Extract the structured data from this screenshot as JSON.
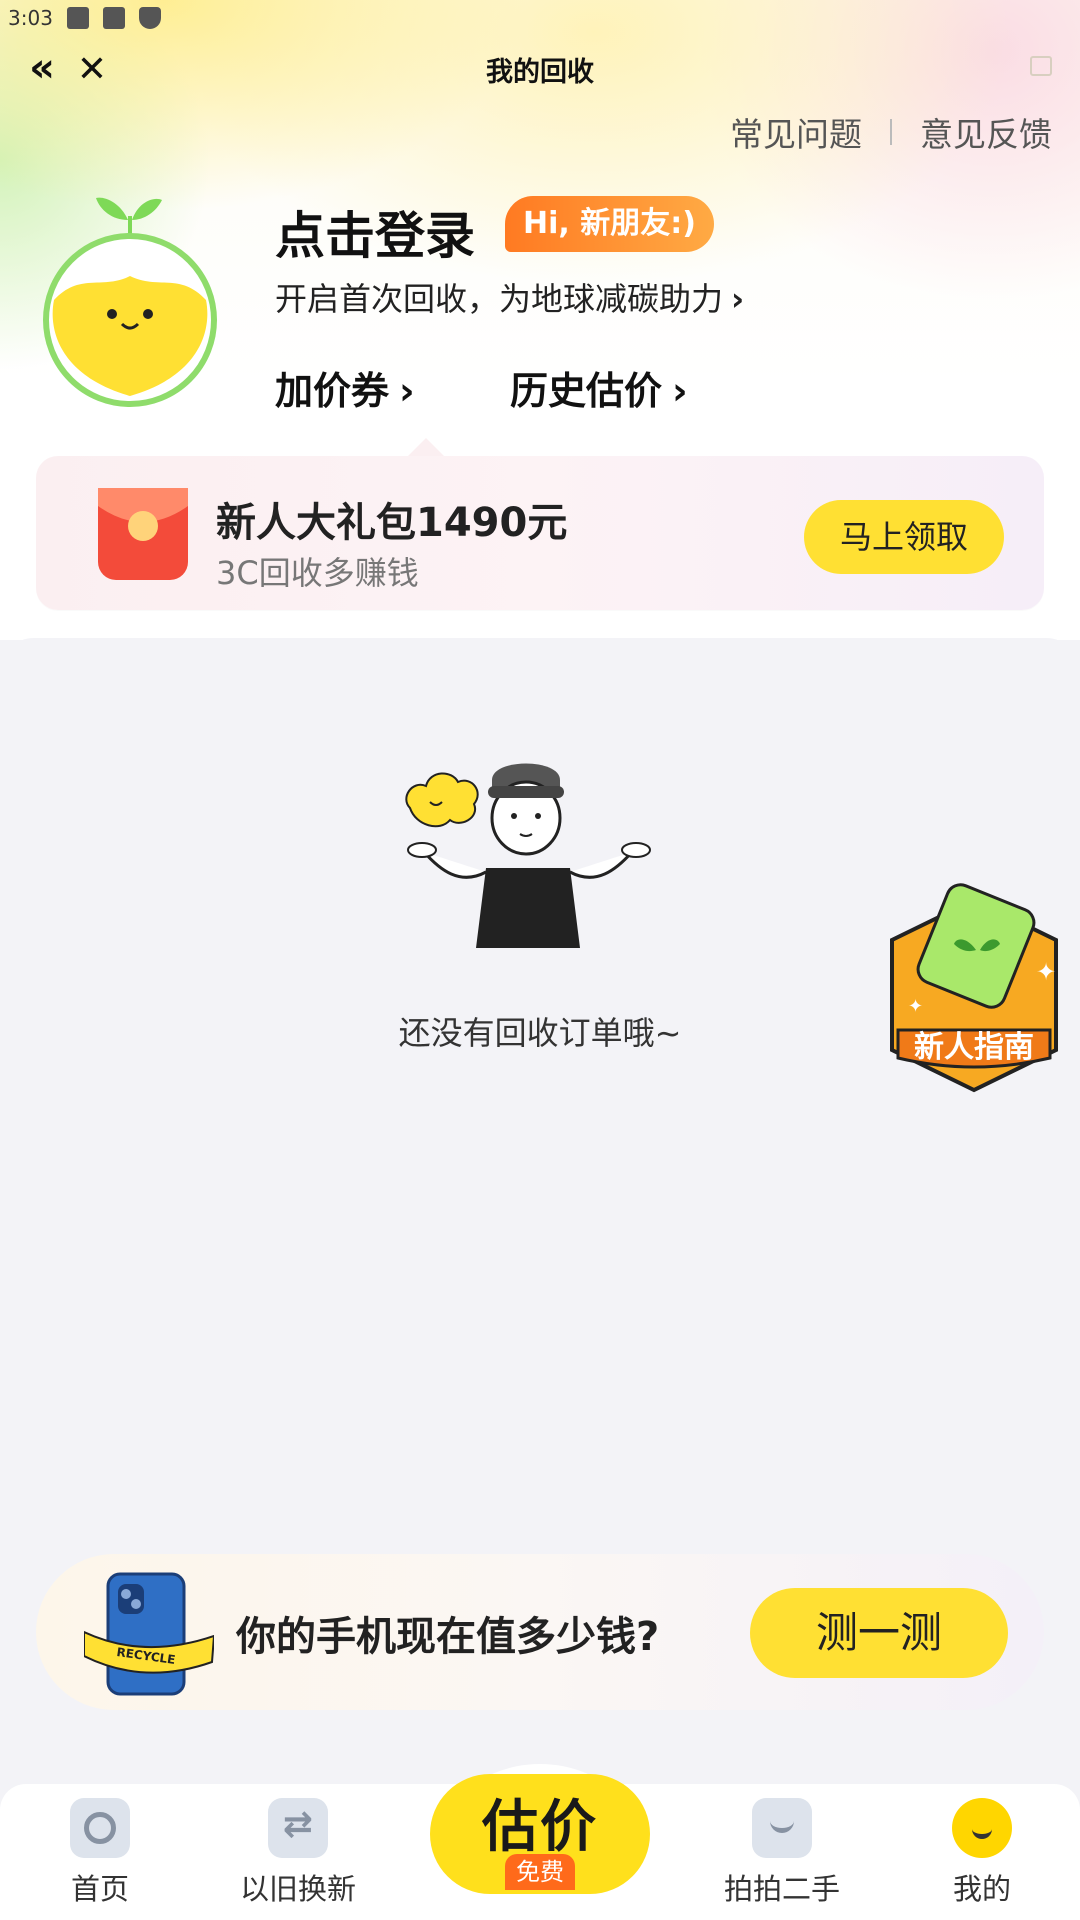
{
  "status_bar": {
    "time": "3:03"
  },
  "header": {
    "title": "我的回收"
  },
  "top_links": {
    "faq": "常见问题",
    "feedback": "意见反馈"
  },
  "profile": {
    "login_title": "点击登录",
    "greeting_badge": "Hi, 新朋友:)",
    "subtitle": "开启首次回收，为地球减碳助力",
    "coupon_label": "加价券",
    "history_label": "历史估价"
  },
  "gift": {
    "title": "新人大礼包1490元",
    "subtitle": "3C回收多赚钱",
    "button": "马上领取"
  },
  "orders": {
    "empty_text": "还没有回收订单哦~"
  },
  "guide_badge": {
    "label": "新人指南"
  },
  "estimate_banner": {
    "question": "你的手机现在值多少钱?",
    "button": "测一测",
    "phone_text": "RECYCLE"
  },
  "bottom_nav": {
    "home": "首页",
    "trade_in": "以旧换新",
    "estimate": "估价",
    "estimate_badge": "免费",
    "second_hand": "拍拍二手",
    "mine": "我的"
  },
  "colors": {
    "accent_yellow": "#ffe033",
    "badge_orange": "#ff7a22",
    "leaf_green": "#7ed957"
  }
}
